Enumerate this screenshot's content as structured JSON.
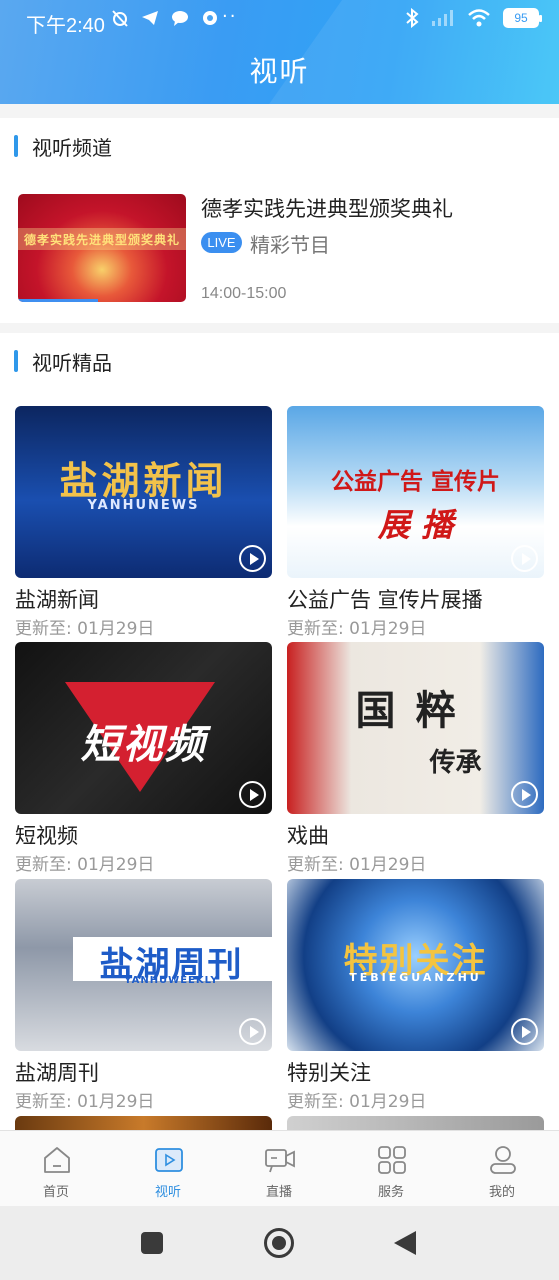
{
  "status_bar": {
    "time": "下午2:40",
    "battery": "95"
  },
  "header": {
    "title": "视听"
  },
  "channel_section": {
    "title": "视听频道",
    "item": {
      "name": "德孝实践先进典型颁奖典礼",
      "badge": "LIVE",
      "description": "精彩节目",
      "time": "14:00-15:00",
      "thumb_text": "德孝实践先进典型颁奖典礼"
    }
  },
  "boutique_section": {
    "title": "视听精品",
    "cards": [
      {
        "name": "盐湖新闻",
        "updated": "更新至: 01月29日",
        "thumb_title": "盐湖新闻",
        "thumb_sub": "YANHUNEWS"
      },
      {
        "name": "公益广告 宣传片展播",
        "updated": "更新至: 01月29日",
        "thumb_title": "公益广告  宣传片",
        "thumb_sub": "展  播"
      },
      {
        "name": "短视频",
        "updated": "更新至: 01月29日",
        "thumb_title": "短视频",
        "thumb_sub": ""
      },
      {
        "name": "戏曲",
        "updated": "更新至: 01月29日",
        "thumb_title": "国粹",
        "thumb_sub": "传承"
      },
      {
        "name": "盐湖周刊",
        "updated": "更新至: 01月29日",
        "thumb_title": "盐湖周刊",
        "thumb_sub": "YANHUWEEKLY"
      },
      {
        "name": "特别关注",
        "updated": "更新至: 01月29日",
        "thumb_title": "特别关注",
        "thumb_sub": "TEBIEGUANZHU"
      }
    ]
  },
  "bottom_nav": {
    "items": [
      {
        "label": "首页",
        "icon": "home-icon"
      },
      {
        "label": "视听",
        "icon": "video-play-icon"
      },
      {
        "label": "直播",
        "icon": "live-camera-icon"
      },
      {
        "label": "服务",
        "icon": "grid-services-icon"
      },
      {
        "label": "我的",
        "icon": "user-icon"
      }
    ],
    "active_index": 1,
    "active_color": "#2f8fe0"
  },
  "colors": {
    "accent": "#2f98ea",
    "header_blue": "#3a9cf3"
  }
}
